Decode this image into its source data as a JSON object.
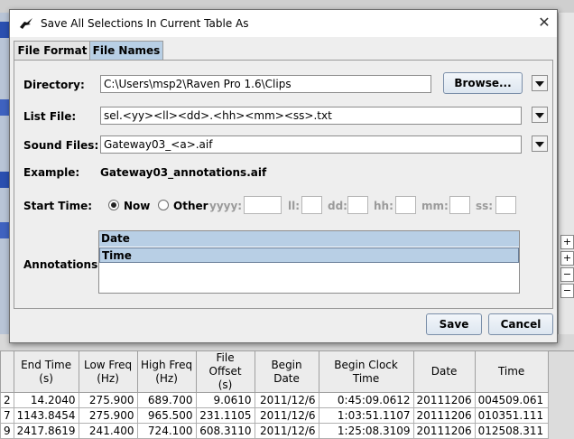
{
  "dialog": {
    "title": "Save All Selections In Current Table As",
    "tabs": [
      "File Format",
      "File Names"
    ],
    "active_tab": "File Names",
    "directory": {
      "label": "Directory:",
      "value": "C:\\Users\\msp2\\Raven Pro 1.6\\Clips",
      "browse_label": "Browse..."
    },
    "list_file": {
      "label": "List File:",
      "value": "sel.<yy><ll><dd>.<hh><mm><ss>.txt"
    },
    "sound_files": {
      "label": "Sound Files:",
      "value": "Gateway03_<a>.aif"
    },
    "example": {
      "label": "Example:",
      "value": "Gateway03_annotations.aif"
    },
    "start_time": {
      "label": "Start Time:",
      "now_label": "Now",
      "other_label": "Other",
      "selected": "Now",
      "fields": [
        "yyyy:",
        "ll:",
        "dd:",
        "hh:",
        "mm:",
        "ss:"
      ]
    },
    "annotations": {
      "label": "Annotations:",
      "items": [
        "Date",
        "Time"
      ],
      "selected": "Time"
    },
    "save_label": "Save",
    "cancel_label": "Cancel"
  },
  "table": {
    "columns": [
      "End Time\n(s)",
      "Low Freq\n(Hz)",
      "High Freq\n(Hz)",
      "File Offset\n(s)",
      "Begin Date",
      "Begin Clock Time",
      "Date",
      "Time"
    ],
    "row_prefixes": [
      "2",
      "7",
      "9"
    ],
    "rows": [
      [
        "14.2040",
        "275.900",
        "689.700",
        "9.0610",
        "2011/12/6",
        "0:45:09.0612",
        "20111206",
        "004509.061"
      ],
      [
        "1143.8454",
        "275.900",
        "965.500",
        "231.1105",
        "2011/12/6",
        "1:03:51.1107",
        "20111206",
        "010351.111"
      ],
      [
        "2417.8619",
        "241.400",
        "724.100",
        "608.3110",
        "2011/12/6",
        "1:25:08.3109",
        "20111206",
        "012508.311"
      ]
    ]
  }
}
